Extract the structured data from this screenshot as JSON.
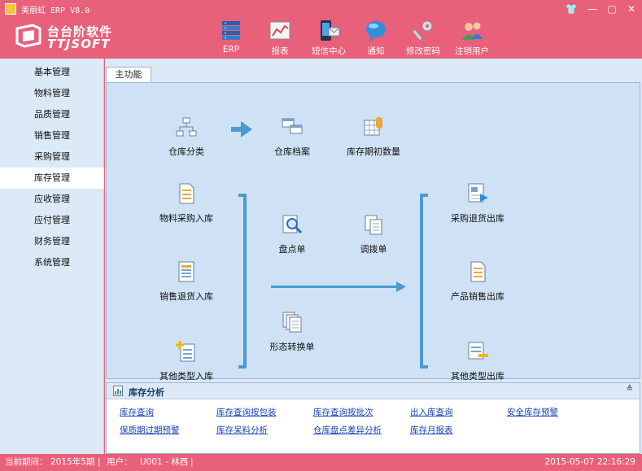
{
  "window": {
    "title": "美丽虹 ERP  V8.0",
    "buttons": [
      "👕",
      "—",
      "▢",
      "✕"
    ]
  },
  "brand": {
    "name_cn": "台台阶软件",
    "name_en": "TTJSOFT"
  },
  "toolbar": [
    {
      "label": "ERP",
      "icon": "server-icon"
    },
    {
      "label": "报表",
      "icon": "chart-icon"
    },
    {
      "label": "短信中心",
      "icon": "phone-message-icon"
    },
    {
      "label": "通知",
      "icon": "speech-bubble-icon"
    },
    {
      "label": "修改密码",
      "icon": "key-icon"
    },
    {
      "label": "注销用户",
      "icon": "users-icon"
    }
  ],
  "sidebar": {
    "items": [
      {
        "label": "基本管理"
      },
      {
        "label": "物料管理"
      },
      {
        "label": "品质管理"
      },
      {
        "label": "销售管理"
      },
      {
        "label": "采购管理"
      },
      {
        "label": "库存管理",
        "active": true
      },
      {
        "label": "应收管理"
      },
      {
        "label": "应付管理"
      },
      {
        "label": "财务管理"
      },
      {
        "label": "系统管理"
      }
    ]
  },
  "tabs": [
    {
      "label": "主功能",
      "active": true
    }
  ],
  "features": {
    "warehouse_category": "仓库分类",
    "warehouse_file": "仓库档案",
    "initial_stock": "库存期初数量",
    "material_purchase_in": "物料采购入库",
    "sales_return_in": "销售退货入库",
    "other_in": "其他类型入库",
    "stock_count": "盘点单",
    "transfer": "调拨单",
    "form_conversion": "形态转换单",
    "purchase_return_out": "采购退货出库",
    "product_sales_out": "产品销售出库",
    "other_out": "其他类型出库"
  },
  "analysis": {
    "title": "库存分析",
    "links_row1": [
      "库存查询",
      "库存查询按包装",
      "库存查询按批次",
      "出入库查询",
      "安全库存预警"
    ],
    "links_row2": [
      "保质期过期预警",
      "库存呆料分析",
      "仓库盘点差异分析",
      "库存月报表"
    ]
  },
  "status": {
    "period_label": "当前期间：",
    "period_value": "2015年5期",
    "user_label": "用户：",
    "user_value": "U001 - 林西",
    "datetime": "2015-05-07 22:16:29"
  },
  "colors": {
    "brand": "#e8607a",
    "panel": "#cfe2f5",
    "sidebar": "#dce9f7",
    "flow": "#4a9ad3",
    "link": "#1b44b5"
  }
}
